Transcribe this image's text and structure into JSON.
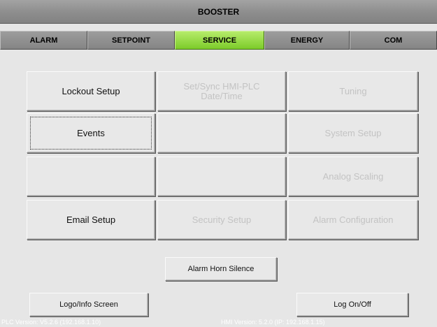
{
  "title": "BOOSTER",
  "tabs": [
    {
      "label": "ALARM",
      "active": false
    },
    {
      "label": "SETPOINT",
      "active": false
    },
    {
      "label": "SERVICE",
      "active": true
    },
    {
      "label": "ENERGY",
      "active": false
    },
    {
      "label": "COM",
      "active": false
    }
  ],
  "grid": {
    "lockout_setup": "Lockout Setup",
    "set_sync_line1": "Set/Sync HMI-PLC",
    "set_sync_line2": "Date/Time",
    "tuning": "Tuning",
    "events": "Events",
    "system_setup": "System Setup",
    "analog_scaling": "Analog Scaling",
    "email_setup": "Email Setup",
    "security_setup": "Security Setup",
    "alarm_configuration": "Alarm Configuration"
  },
  "alarm_horn_silence": "Alarm Horn Silence",
  "logo_info_screen": "Logo/Info Screen",
  "log_on_off": "Log On/Off",
  "footer": {
    "plc_version": "PLC Version: V5.2.6   (192.168.1.10)",
    "hmi_version": "HMI Version: 5.2.0 (IP: 192.168.1.15)"
  },
  "colors": {
    "active_tab": "#7ccb2a",
    "tab": "#8d8d8d",
    "background": "#e6e6e6",
    "disabled_text": "#c3c3c3"
  }
}
